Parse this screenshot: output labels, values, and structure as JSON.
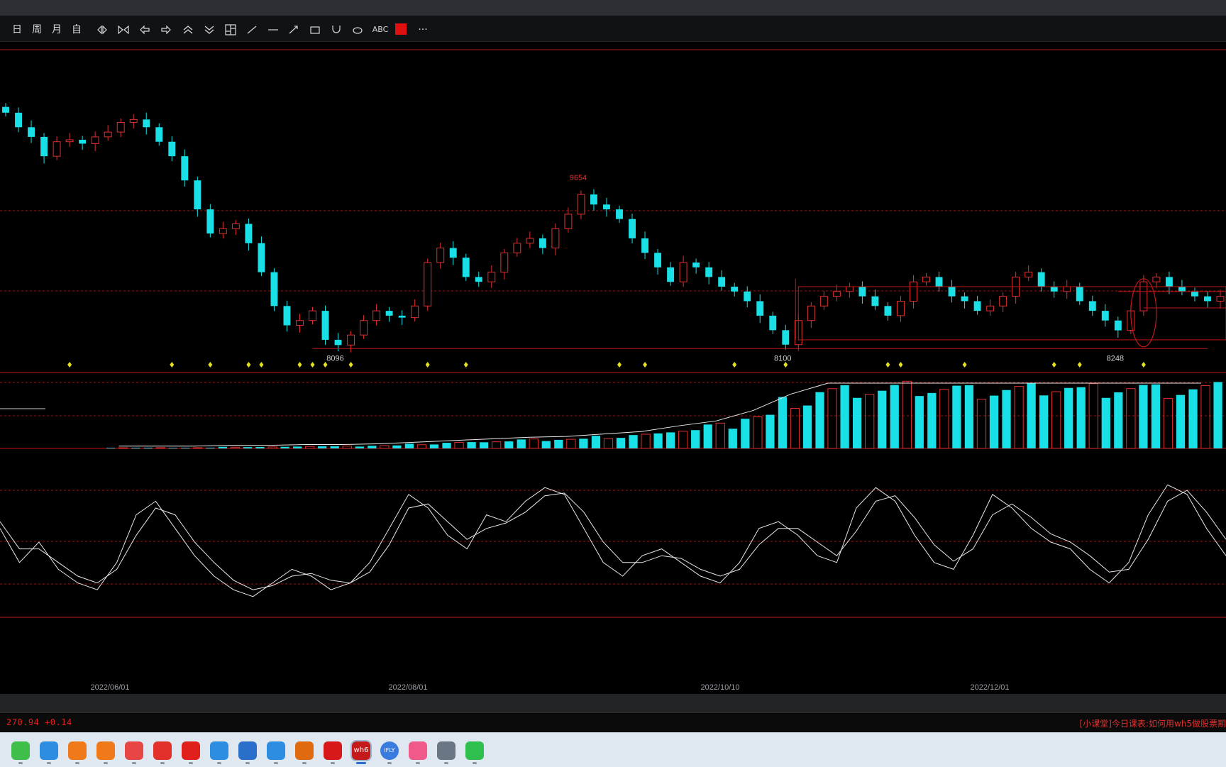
{
  "toolbar": {
    "period_labels": [
      "日",
      "周",
      "月",
      "自"
    ],
    "text_tool_label": "ABC",
    "more_label": "···",
    "color_swatch": "#e01010"
  },
  "status_bar": {
    "index_text": "270.94  +0.14",
    "ticker_text": "[小课堂]今日课表:如何用wh5做股票期"
  },
  "taskbar": {
    "apps": [
      "browser-green-icon",
      "edge-icon",
      "app-orange-icon",
      "app-orange2-icon",
      "cards-icon",
      "listen-icon",
      "stock-red-icon",
      "chart-blue-icon",
      "notepad-icon",
      "edge2-icon",
      "tiger-icon",
      "wps-icon",
      "wh6-icon",
      "ifly-icon",
      "camera-pink-icon",
      "settings-icon",
      "wechat-icon"
    ],
    "labels": {
      "wh6": "wh6",
      "ifly": "iFLY"
    }
  },
  "colors": {
    "up": "#e03030",
    "down": "#18e0e6",
    "frame": "#c01818",
    "grid": "#8a1a1a",
    "marker": "#e6e020",
    "line": "#e8e8e8"
  },
  "chart_data": [
    {
      "type": "candlestick",
      "x_ticks": [
        "2022/06/01",
        "2022/08/01",
        "2022/10/10",
        "2022/12/01"
      ],
      "annotations": [
        {
          "text": "9654",
          "kind": "high"
        },
        {
          "text": "8096",
          "kind": "low"
        },
        {
          "text": "8100",
          "kind": "low"
        },
        {
          "text": "8248",
          "kind": "low"
        }
      ],
      "values_approx": [
        10500,
        10350,
        10250,
        10050,
        10200,
        10220,
        10180,
        10250,
        10300,
        10400,
        10430,
        10350,
        10200,
        10050,
        9800,
        9500,
        9250,
        9300,
        9350,
        9150,
        8850,
        8500,
        8300,
        8350,
        8450,
        8150,
        8096,
        8200,
        8350,
        8450,
        8400,
        8380,
        8500,
        8950,
        9100,
        9000,
        8800,
        8750,
        8850,
        9050,
        9150,
        9200,
        9100,
        9300,
        9450,
        9654,
        9550,
        9500,
        9400,
        9200,
        9050,
        8900,
        8750,
        8950,
        8900,
        8800,
        8700,
        8650,
        8550,
        8400,
        8250,
        8100,
        8350,
        8500,
        8600,
        8650,
        8700,
        8600,
        8500,
        8400,
        8550,
        8750,
        8800,
        8700,
        8600,
        8550,
        8450,
        8500,
        8600,
        8800,
        8850,
        8700,
        8650,
        8700,
        8550,
        8450,
        8350,
        8248,
        8450,
        8750,
        8800,
        8700,
        8650,
        8600,
        8550,
        8600
      ],
      "frame": "candles with price-range rectangles"
    },
    {
      "type": "bar",
      "panel": "volume / open interest",
      "series": [
        {
          "values": [
            0.1,
            0.1,
            0.1,
            0.2,
            0.2,
            0.3,
            0.3,
            0.4,
            0.6,
            0.8,
            1.0,
            1.2,
            1.3,
            1.6,
            1.9,
            2.6,
            3.2,
            4.5,
            6.5,
            8.0,
            8.2,
            8.5,
            8.4,
            8.0,
            8.3,
            8.6,
            8.2,
            8.5,
            8.1,
            8.4
          ]
        }
      ]
    },
    {
      "type": "line",
      "panel": "oscillator",
      "series": [
        {
          "values": [
            60,
            35,
            50,
            30,
            20,
            15,
            35,
            70,
            80,
            60,
            40,
            25,
            15,
            10,
            20,
            30,
            25,
            15,
            20,
            35,
            60,
            85,
            75,
            55,
            45,
            70,
            65,
            80,
            90,
            85,
            60,
            35,
            25,
            40,
            45,
            35,
            25,
            20,
            35,
            60,
            65,
            55,
            40,
            35,
            75,
            90,
            80,
            55,
            35,
            30,
            55,
            85,
            75,
            60,
            50,
            45,
            30,
            20,
            35,
            70,
            92,
            85,
            60,
            40
          ]
        },
        {
          "values": [
            65,
            45,
            45,
            35,
            25,
            20,
            30,
            55,
            75,
            70,
            50,
            35,
            22,
            15,
            18,
            25,
            27,
            22,
            20,
            28,
            48,
            75,
            78,
            65,
            52,
            60,
            64,
            72,
            84,
            86,
            72,
            50,
            35,
            35,
            40,
            38,
            30,
            25,
            30,
            48,
            60,
            60,
            50,
            40,
            58,
            80,
            84,
            68,
            48,
            36,
            45,
            70,
            78,
            68,
            56,
            50,
            40,
            28,
            30,
            52,
            80,
            88,
            72,
            52
          ]
        }
      ]
    }
  ]
}
